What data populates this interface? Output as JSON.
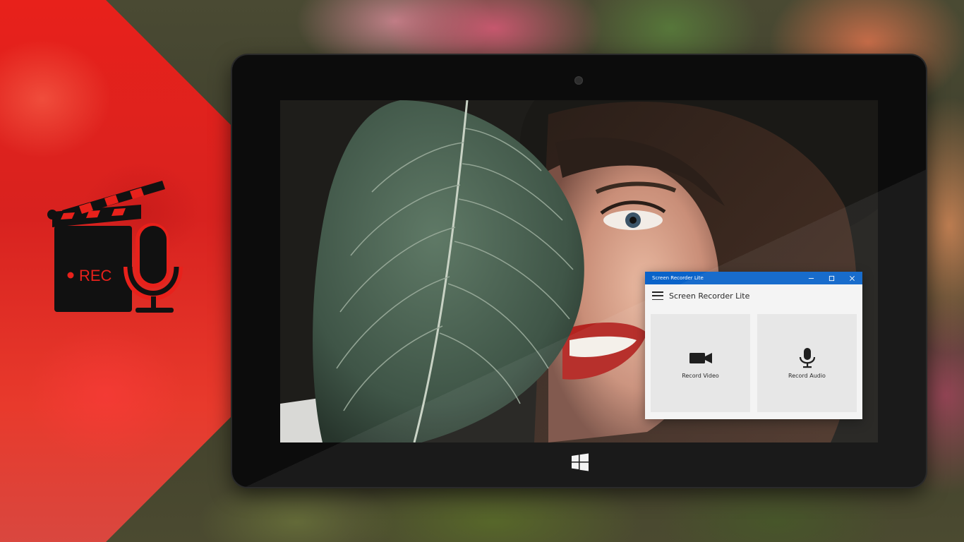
{
  "logo": {
    "rec_text": "REC"
  },
  "app": {
    "window_title": "Screen Recorder Lite",
    "header_title": "Screen Recorder Lite",
    "tiles": [
      {
        "label": "Record Video",
        "icon": "video-camera-icon"
      },
      {
        "label": "Record Audio",
        "icon": "microphone-icon"
      }
    ],
    "accent_color": "#0a63c9"
  },
  "theme": {
    "brand_red": "#e8211b"
  }
}
